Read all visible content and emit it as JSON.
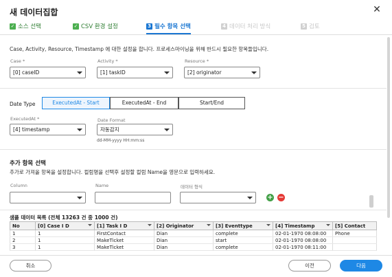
{
  "dialog": {
    "title": "새 데이터집합",
    "close_label": "✕"
  },
  "steps": [
    {
      "marker": "✓",
      "label": "소스 선택",
      "state": "done"
    },
    {
      "marker": "✓",
      "label": "CSV 환경 설정",
      "state": "done"
    },
    {
      "marker": "3",
      "label": "필수 항목 선택",
      "state": "active"
    },
    {
      "marker": "4",
      "label": "데이터 처리 방식",
      "state": "off"
    },
    {
      "marker": "5",
      "label": "검토",
      "state": "off"
    }
  ],
  "required": {
    "description": "Case, Activity, Resource, Timestamp 에 대한 설정을 합니다. 프로세스마이닝을 위해 반드시 필요한 항목들입니다.",
    "case": {
      "label": "Case *",
      "value": "[0] caseID"
    },
    "activity": {
      "label": "Activity *",
      "value": "[1] taskID"
    },
    "resource": {
      "label": "Resource *",
      "value": "[2] originator"
    }
  },
  "date_type": {
    "label": "Date Type",
    "options": [
      "ExecutedAt - Start",
      "ExecutedAt - End",
      "Start/End"
    ],
    "selected_index": 0,
    "executed_at": {
      "label": "ExecutedAt *",
      "value": "[4] timestamp"
    },
    "date_format": {
      "label": "Date Format",
      "value": "자동감지",
      "hint": "dd-MM-yyyy HH:mm:ss"
    }
  },
  "additional": {
    "title": "추가 항목 선택",
    "description": "추가로 가져올 항목을 설정합니다. 컬럼명을 선택후 설정할 컬럼 Name을 영문으로 입력하세요.",
    "column_label": "Column",
    "name_label": "Name",
    "type_label": "데이터 형식",
    "add_label": "+",
    "remove_label": "−"
  },
  "sample": {
    "title": "샘플 데이터 목록 (전체 13263 건 중 1000 건)",
    "columns": [
      "No",
      "[0] Case I D",
      "[1] Task I D",
      "[2] Originator",
      "[3] Eventtype",
      "[4] Timestamp",
      "[5] Contact"
    ],
    "rows": [
      [
        "1",
        "1",
        "FirstContact",
        "Dian",
        "complete",
        "02-01-1970 08:08:00",
        "Phone"
      ],
      [
        "2",
        "1",
        "MakeTicket",
        "Dian",
        "start",
        "02-01-1970 08:08:00",
        ""
      ],
      [
        "3",
        "1",
        "MakeTicket",
        "Dian",
        "complete",
        "02-01-1970 08:11:00",
        ""
      ]
    ]
  },
  "footer": {
    "cancel": "취소",
    "prev": "이전",
    "next": "다음"
  },
  "colors": {
    "accent": "#1e88e5",
    "done": "#2e7d32",
    "add": "#43a047",
    "remove": "#e53935"
  }
}
